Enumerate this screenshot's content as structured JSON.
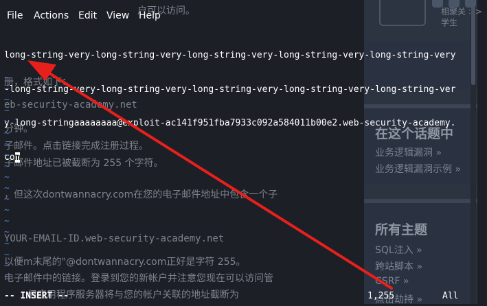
{
  "terminal": {
    "menu": [
      "File",
      "Actions",
      "Edit",
      "View",
      "Help"
    ],
    "buffer_lines": [
      "long-string-very-long-string-very-long-string-very-long-string-very-long-string-very",
      "-long-string-very-long-string-very-long-string-very-long-string-very-long-string-ver",
      "y-long-stringaaaaaaaa@exploit-ac141f951fba7933c092a584011b00e2.web-security-academy.",
      "co"
    ],
    "cursor_char": "m",
    "tilde": "~",
    "tilde_count": 19,
    "status": {
      "mode": "-- INSERT --",
      "position": "1,255",
      "scroll": "All"
    }
  },
  "background": {
    "lines": [
      "户可以访问。",
      "册，格式如下：",
      "eb-security-academy.net",
      "分钟。",
      "子邮件。点击链接完成注册过程。",
      "子邮件地址已被截断为 255 个字符。",
      "，但这次dontwannacry.com在您的电子邮件地址中包含一个子",
      "YOUR-EMAIL-ID.web-security-academy.net",
      "以便m末尾的\"@dontwannacry.com正好是字符 255。",
      "电子邮件中的链接。登录到您的新帐户并注意您现在可以访问管",
      "但应用程序服务器将与您的帐户关联的地址截断为"
    ],
    "sidebar": {
      "top_labels": [
        "相聚关 >>",
        "学生"
      ],
      "topic_title": "在这个话题中",
      "topic_links": [
        "业务逻辑漏洞 »",
        "业务逻辑漏洞示例 »"
      ],
      "all_title": "所有主题",
      "all_links": [
        "SQL注入 »",
        "跨站脚本 »",
        "CSRF »",
        "点击劫持 »"
      ]
    }
  },
  "colors": {
    "terminal_bg": "#1c1f26",
    "tilde": "#4e7ac7",
    "arrow": "#e8201c",
    "text": "#ffffff"
  }
}
